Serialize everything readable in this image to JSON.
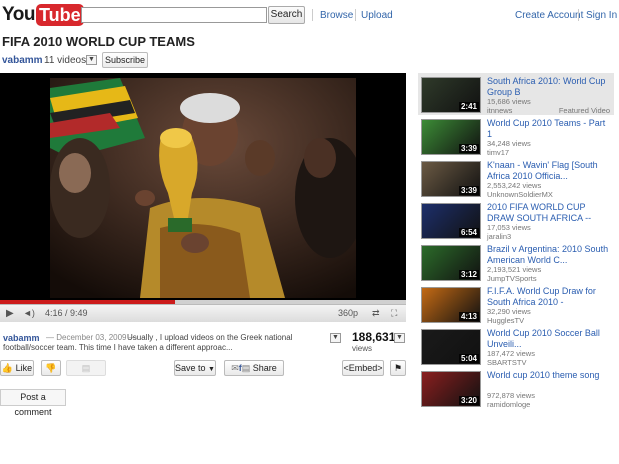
{
  "header": {
    "logo_you": "You",
    "logo_tube": "Tube",
    "search_button": "Search",
    "browse": "Browse",
    "upload": "Upload",
    "create_account": "Create Account",
    "sign_in": "Sign In"
  },
  "title": "FIFA 2010 WORLD CUP TEAMS",
  "channel": {
    "name": "vabamm",
    "video_count": "11 videos",
    "subscribe": "Subscribe"
  },
  "player": {
    "time": "4:16 / 9:49",
    "quality": "360p",
    "progress": 0.43
  },
  "info": {
    "user": "vabamm",
    "date": "— December 03, 2009 —",
    "desc_line1": "Usually , I upload videos on the Greek national",
    "desc_line2": "football/soccer team. This time I have taken a different approac...",
    "views": "188,631",
    "views_label": "views"
  },
  "actions": {
    "like": "Like",
    "save_to": "Save to",
    "share": "Share",
    "embed": "<Embed>"
  },
  "post_comment": "Post a comment",
  "sidebar": {
    "featured_label": "Featured Video",
    "items": [
      {
        "title": "South Africa 2010: World Cup Group B",
        "views": "15,686 views",
        "author": "itnnews",
        "duration": "2:41",
        "color": "#2f3a2a"
      },
      {
        "title": "World Cup 2010 Teams - Part 1",
        "views": "34,248 views",
        "author": "timv17",
        "duration": "3:39",
        "color": "#3c8c36"
      },
      {
        "title": "K'naan - Wavin' Flag [South Africa 2010 Officia...",
        "views": "2,553,242 views",
        "author": "UnknownSoldierMX",
        "duration": "3:39",
        "color": "#6b5a44"
      },
      {
        "title": "2010 FIFA WORLD CUP DRAW SOUTH AFRICA --",
        "views": "17,053 views",
        "author": "jaralin3",
        "duration": "6:54",
        "color": "#1d2f6b"
      },
      {
        "title": "Brazil v Argentina: 2010 South American World C...",
        "views": "2,193,521 views",
        "author": "JumpTVSports",
        "duration": "3:12",
        "color": "#2c6b2a"
      },
      {
        "title": "F.I.F.A. World Cup Draw for South Africa 2010 -",
        "views": "32,290 views",
        "author": "HugglesTV",
        "duration": "4:13",
        "color": "#c46a14"
      },
      {
        "title": "World Cup 2010 Soccer Ball Unveili...",
        "views": "187,472 views",
        "author": "SBARTSTV",
        "duration": "5:04",
        "color": "#1a1a1a"
      },
      {
        "title": "World cup 2010 theme song",
        "views": "972,878 views",
        "author": "ramidomloge",
        "duration": "3:20",
        "color": "#8a1f1f"
      }
    ]
  }
}
